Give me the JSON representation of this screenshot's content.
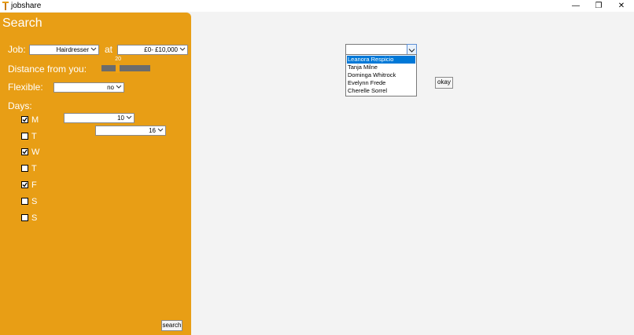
{
  "window": {
    "title": "jobshare",
    "controls": {
      "minimize": "—",
      "maximize": "❐",
      "close": "✕"
    }
  },
  "sidebar": {
    "title": "Search",
    "job_label": "Job:",
    "job_value": "Hairdresser",
    "at_label": "at",
    "salary_value": "£0- £10,000",
    "distance_label": "Distance from you:",
    "distance_value": "20",
    "distance_fraction": 0.32,
    "flexible_label": "Flexible:",
    "flexible_value": "no",
    "days_label": "Days:",
    "time_start_value": "10",
    "time_end_value": "16",
    "days": [
      {
        "label": "M",
        "checked": true
      },
      {
        "label": "T",
        "checked": false
      },
      {
        "label": "W",
        "checked": true
      },
      {
        "label": "T",
        "checked": false
      },
      {
        "label": "F",
        "checked": true
      },
      {
        "label": "S",
        "checked": false
      },
      {
        "label": "S",
        "checked": false
      }
    ],
    "search_button": "search"
  },
  "main": {
    "combo_value": "",
    "list_items": [
      {
        "label": "Leanora Respicio",
        "selected": true
      },
      {
        "label": "Tanja Milne",
        "selected": false
      },
      {
        "label": "Dominga Whitrock",
        "selected": false
      },
      {
        "label": "Evelynn Frede",
        "selected": false
      },
      {
        "label": "Cherelle Sorrel",
        "selected": false
      }
    ],
    "okay_button": "okay"
  },
  "colors": {
    "panel": "#e89e15",
    "selection": "#0078d7",
    "slider_track": "#6c6c6c",
    "slider_thumb": "#f3a312"
  }
}
